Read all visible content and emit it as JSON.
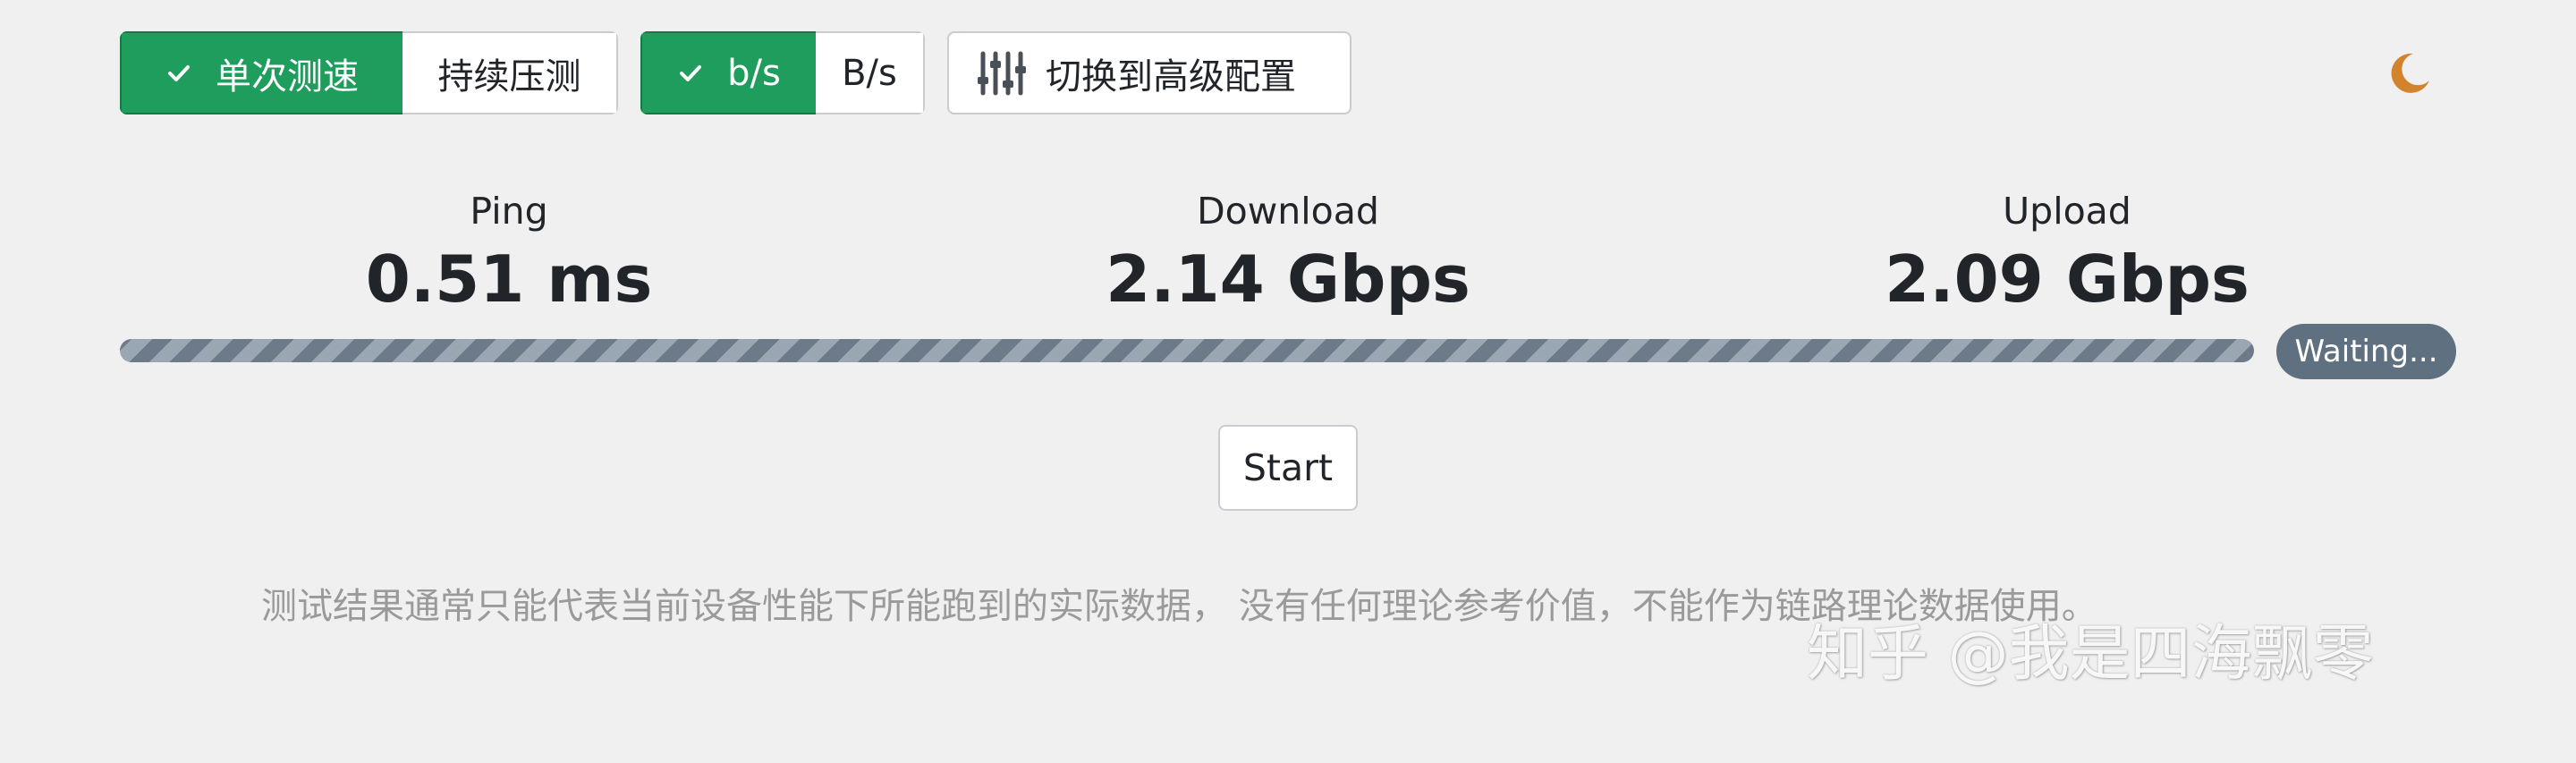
{
  "toolbar": {
    "mode_group": {
      "single_label": "单次测速",
      "continuous_label": "持续压测",
      "active": "single"
    },
    "unit_group": {
      "bits_label": "b/s",
      "bytes_label": "B/s",
      "active": "bits"
    },
    "advanced_config_label": "切换到高级配置",
    "theme_icon": "moon-icon"
  },
  "stats": {
    "ping": {
      "label": "Ping",
      "value": "0.51 ms"
    },
    "download": {
      "label": "Download",
      "value": "2.14 Gbps"
    },
    "upload": {
      "label": "Upload",
      "value": "2.09 Gbps"
    }
  },
  "progress": {
    "status": "Waiting..."
  },
  "start_label": "Start",
  "disclaimer": "测试结果通常只能代表当前设备性能下所能跑到的实际数据， 没有任何理论参考价值，不能作为链路理论数据使用。",
  "watermark": "知乎 @我是四海飘零",
  "colors": {
    "accent": "#1f9d5c",
    "background": "#f0f0f0",
    "badge": "#5f7080",
    "moon": "#d2832b"
  }
}
